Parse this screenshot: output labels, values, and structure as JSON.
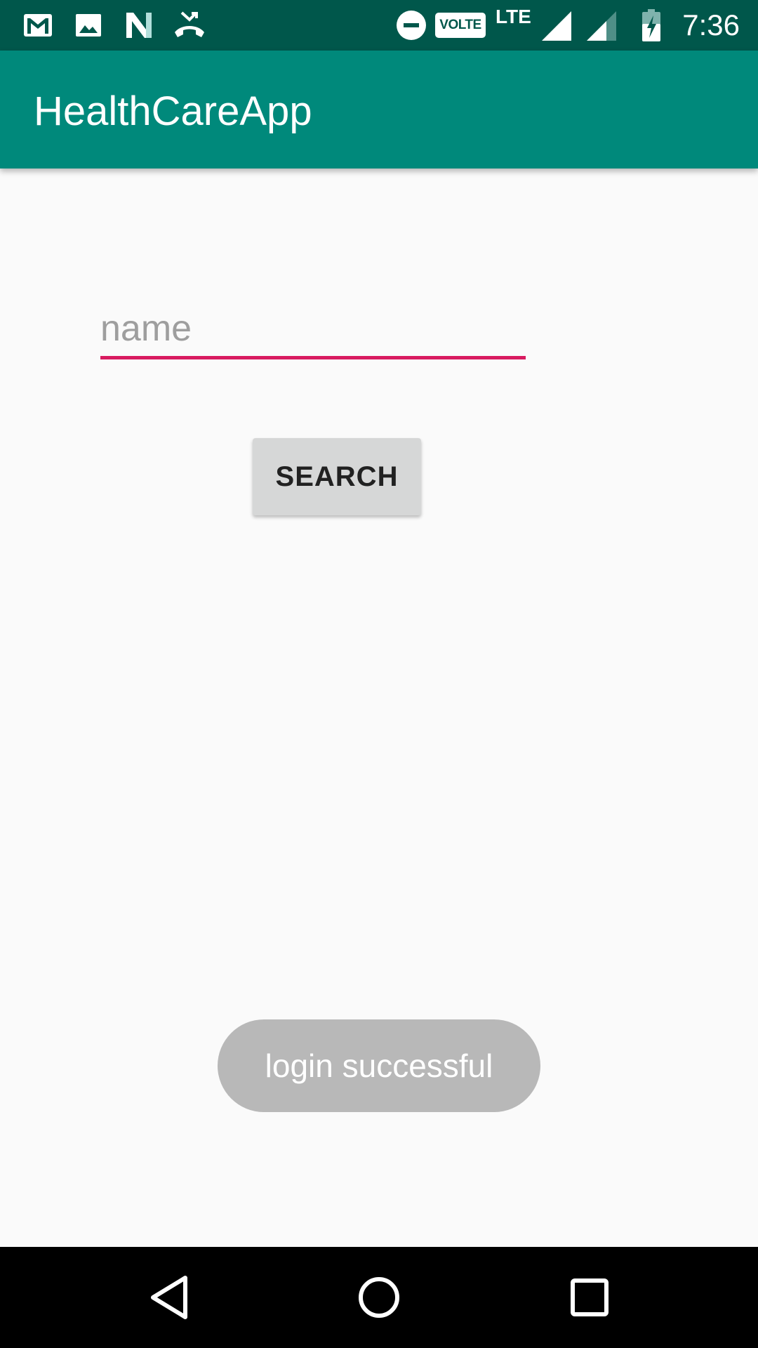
{
  "status_bar": {
    "time": "7:36",
    "volte_label": "VOLTE",
    "network_label": "LTE",
    "icons": [
      "gmail-icon",
      "gallery-icon",
      "n-icon",
      "missed-call-icon",
      "do-not-disturb-icon",
      "volte-icon",
      "signal-icon",
      "signal-icon",
      "battery-charging-icon"
    ]
  },
  "app_bar": {
    "title": "HealthCareApp",
    "color": "#00897b",
    "status_color": "#00574b"
  },
  "form": {
    "name_placeholder": "name",
    "name_value": "",
    "search_label": "SEARCH",
    "accent_color": "#d81b60"
  },
  "toast": {
    "message": "login successful"
  },
  "nav_bar": {
    "icons": [
      "back-icon",
      "home-icon",
      "recents-icon"
    ]
  }
}
